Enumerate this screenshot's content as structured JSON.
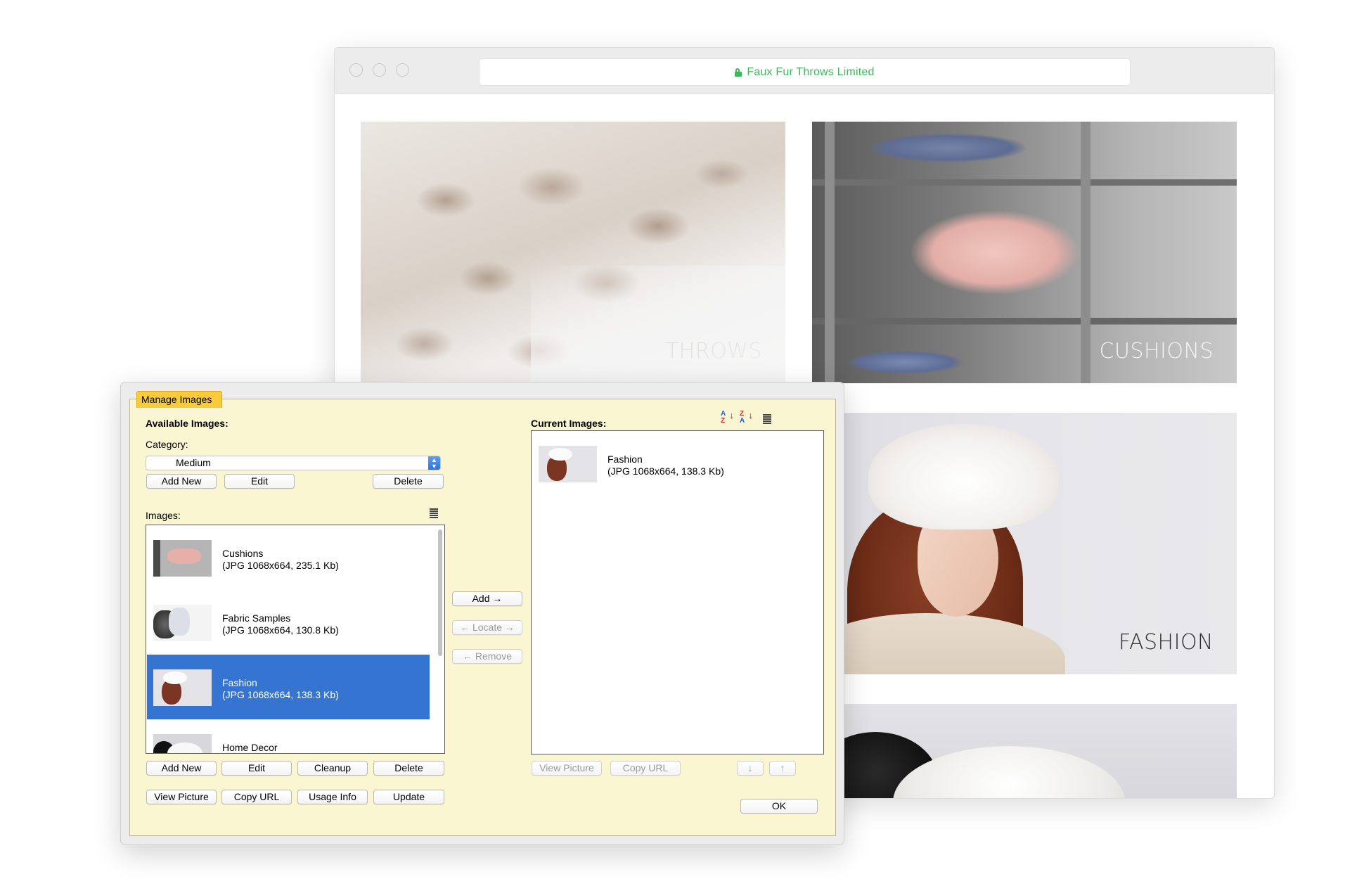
{
  "browser": {
    "url_text": "Faux Fur Throws Limited",
    "tiles": [
      {
        "caption": "THROWS"
      },
      {
        "caption": "CUSHIONS"
      },
      {
        "caption": "FASHION"
      }
    ]
  },
  "dialog": {
    "title": "Manage Images",
    "available_heading": "Available Images:",
    "category_label": "Category:",
    "category_value": "Medium",
    "category_buttons": {
      "add_new": "Add New",
      "edit": "Edit",
      "delete": "Delete"
    },
    "images_label": "Images:",
    "images": [
      {
        "name": "Cushions",
        "details": "(JPG 1068x664, 235.1 Kb)",
        "selected": false
      },
      {
        "name": "Fabric Samples",
        "details": "(JPG 1068x664, 130.8 Kb)",
        "selected": false
      },
      {
        "name": "Fashion",
        "details": "(JPG 1068x664, 138.3 Kb)",
        "selected": true
      },
      {
        "name": "Home Decor",
        "details": "",
        "selected": false
      }
    ],
    "image_buttons_row1": {
      "add_new": "Add New",
      "edit": "Edit",
      "cleanup": "Cleanup",
      "delete": "Delete"
    },
    "image_buttons_row2": {
      "view_picture": "View Picture",
      "copy_url": "Copy URL",
      "usage_info": "Usage Info",
      "update": "Update"
    },
    "middle_buttons": {
      "add": "Add →",
      "locate": "← Locate →",
      "remove": "← Remove"
    },
    "current_heading": "Current Images:",
    "current_images": [
      {
        "name": "Fashion",
        "details": "(JPG 1068x664, 138.3 Kb)"
      }
    ],
    "current_buttons": {
      "view_picture": "View Picture",
      "copy_url": "Copy URL",
      "down": "↓",
      "up": "↑"
    },
    "ok": "OK"
  },
  "colors": {
    "url_green": "#3cb85c",
    "dialog_bg": "#fbf6d2",
    "tab_yellow": "#f7cb3b",
    "selection_blue": "#3574d0"
  },
  "icons": [
    "lock-icon",
    "list-view-icon",
    "sort-ascending-icon",
    "sort-descending-icon",
    "select-arrows-icon"
  ]
}
